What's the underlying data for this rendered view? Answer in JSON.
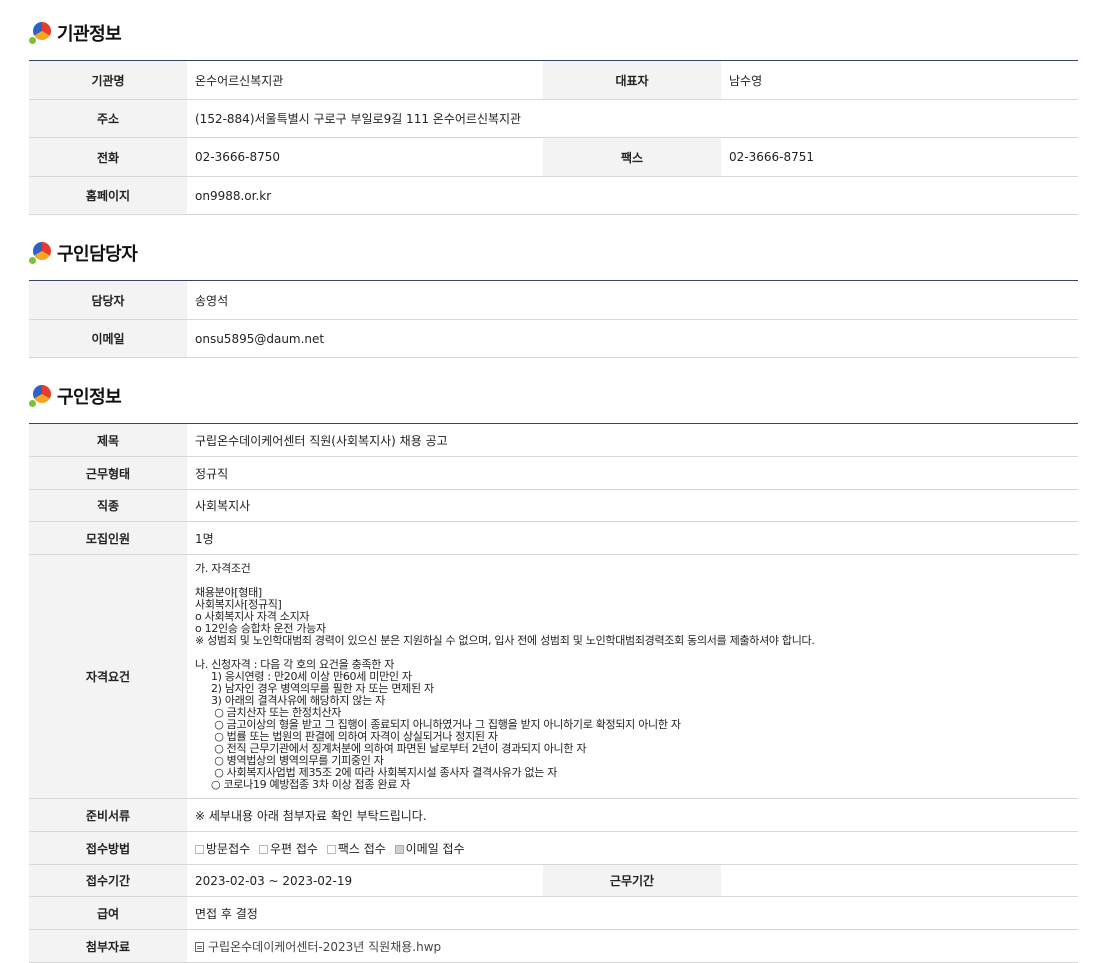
{
  "org": {
    "heading": "기관정보",
    "name_label": "기관명",
    "name_value": "온수어르신복지관",
    "rep_label": "대표자",
    "rep_value": "남수영",
    "addr_label": "주소",
    "addr_value": "(152-884)서울특별시 구로구 부일로9길 111 온수어르신복지관",
    "tel_label": "전화",
    "tel_value": "02-3666-8750",
    "fax_label": "팩스",
    "fax_value": "02-3666-8751",
    "home_label": "홈페이지",
    "home_value": "on9988.or.kr"
  },
  "contact": {
    "heading": "구인담당자",
    "person_label": "담당자",
    "person_value": "송영석",
    "email_label": "이메일",
    "email_value": "onsu5895@daum.net"
  },
  "job": {
    "heading": "구인정보",
    "title_label": "제목",
    "title_value": "구립온수데이케어센터 직원(사회복지사) 채용 공고",
    "type_label": "근무형태",
    "type_value": "정규직",
    "occ_label": "직종",
    "occ_value": "사회복지사",
    "count_label": "모집인원",
    "count_value": "1명",
    "qual_label": "자격요건",
    "qual_value": "가. 자격조건\n\n채용분야[형태]\n사회복지사[정규직]\no 사회복지사 자격 소지자\no 12인승 승합차 운전 가능자\n※ 성범죄 및 노인학대범죄 경력이 있으신 분은 지원하실 수 없으며, 입사 전에 성범죄 및 노인학대범죄경력조회 동의서를 제출하셔야 합니다.\n\n나. 신청자격 : 다음 각 호의 요건을 충족한 자\n     1) 응시연령 : 만20세 이상 만60세 미만인 자\n     2) 남자인 경우 병역의무를 필한 자 또는 면제된 자\n     3) 아래의 결격사유에 해당하지 않는 자\n      ○ 금치산자 또는 한정치산자\n      ○ 금고이상의 형을 받고 그 집행이 종료되지 아니하였거나 그 집행을 받지 아니하기로 확정되지 아니한 자\n      ○ 법률 또는 법원의 판결에 의하여 자격이 상실되거나 정지된 자\n      ○ 전직 근무기관에서 징계처분에 의하여 파면된 날로부터 2년이 경과되지 아니한 자\n      ○ 병역법상의 병역의무를 기피중인 자\n      ○ 사회복지사업법 제35조 2에 따라 사회복지시설 종사자 결격사유가 없는 자\n     ○ 코로나19 예방접종 3차 이상 접종 완료 자",
    "docs_label": "준비서류",
    "docs_value": "※ 세부내용 아래 첨부자료 확인 부탁드립니다.",
    "method_label": "접수방법",
    "methods": [
      {
        "label": "방문접수",
        "checked": false
      },
      {
        "label": "우편 접수",
        "checked": false
      },
      {
        "label": "팩스 접수",
        "checked": false
      },
      {
        "label": "이메일 접수",
        "checked": true
      }
    ],
    "period_label": "접수기간",
    "period_value": "2023-02-03 ~ 2023-02-19",
    "workperiod_label": "근무기간",
    "workperiod_value": "",
    "pay_label": "급여",
    "pay_value": "면접 후 결정",
    "attach_label": "첨부자료",
    "attach_value": "구립온수데이케어센터-2023년 직원채용.hwp"
  }
}
